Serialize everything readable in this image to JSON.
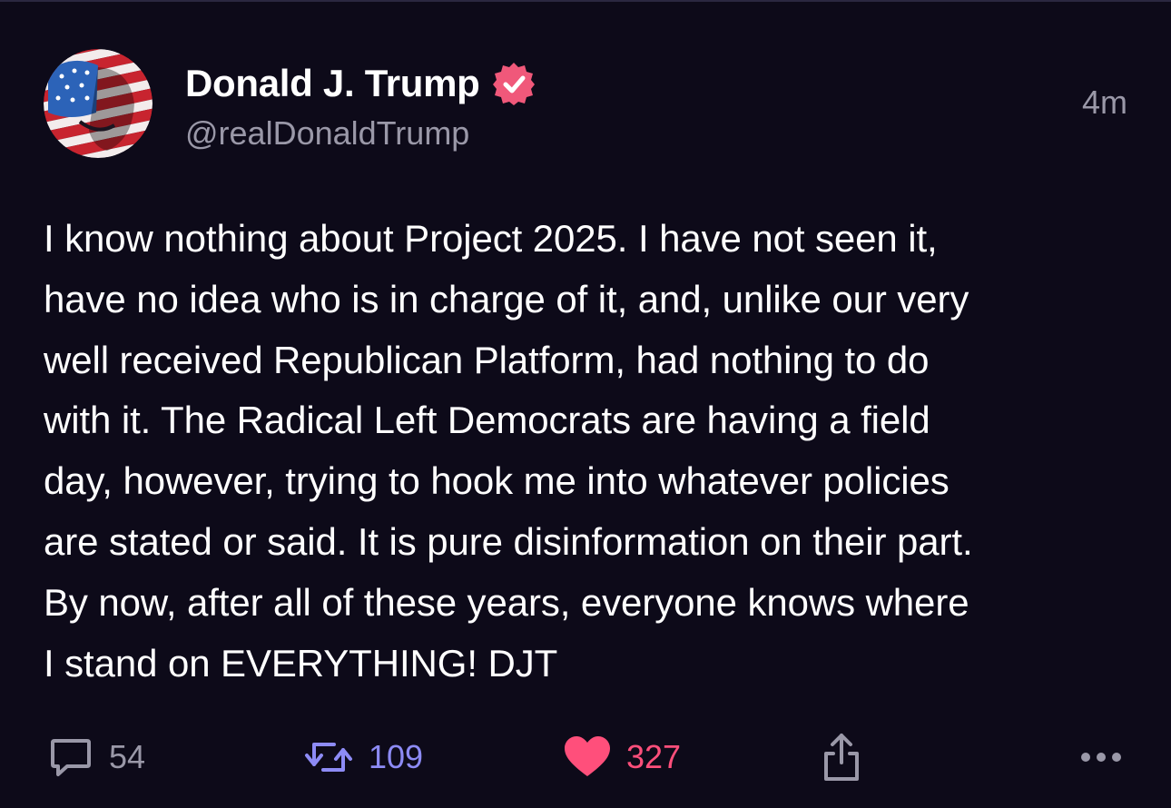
{
  "post": {
    "author": {
      "display_name": "Donald J. Trump",
      "handle": "@realDonaldTrump",
      "verified": true,
      "avatar_icon": "flag-face-avatar"
    },
    "timestamp": "4m",
    "body_lines": [
      "I know nothing about Project 2025. I have not seen it,",
      "have no idea who is in charge of it, and, unlike our very",
      "well received Republican Platform, had nothing to do",
      "with it. The Radical Left Democrats are having a field",
      "day, however, trying to hook me into whatever policies",
      "are stated or said. It is pure disinformation on their part.",
      "By now, after all of these years, everyone knows where",
      "I stand on EVERYTHING! DJT"
    ],
    "actions": {
      "reply": {
        "icon": "comment-icon",
        "count": "54"
      },
      "repost": {
        "icon": "repost-icon",
        "count": "109"
      },
      "like": {
        "icon": "heart-icon",
        "count": "327"
      },
      "share": {
        "icon": "share-icon"
      },
      "more": {
        "icon": "more-icon"
      }
    }
  },
  "colors": {
    "background": "#0d0a19",
    "text": "#ffffff",
    "muted": "#9a98a8",
    "verified_badge": "#f0587a",
    "repost_accent": "#8d8bf5",
    "like_accent": "#ff4f7b"
  }
}
